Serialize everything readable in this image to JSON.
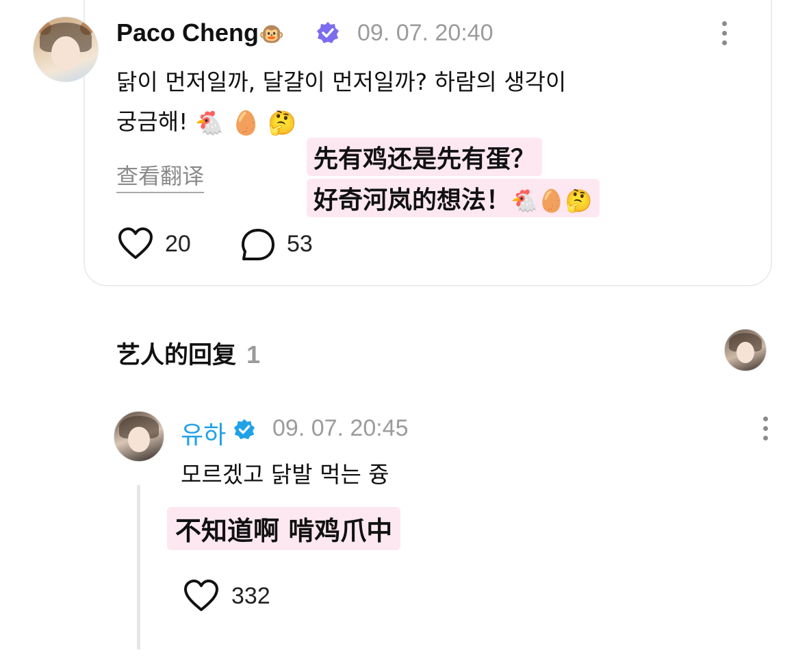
{
  "post": {
    "author": "Paco Cheng",
    "author_emoji": "🐵",
    "timestamp": "09. 07. 20:40",
    "text_line1": "닭이 먼저일까, 달걀이 먼저일까? 하람의 생각이",
    "text_line2": "궁금해!",
    "text_emojis": "🐔 🥚 🤔",
    "translate_label": "查看翻译",
    "translation_line1": "先有鸡还是先有蛋？",
    "translation_line2": "好奇河岚的想法！",
    "translation_emojis": "🐔🥚🤔",
    "likes": "20",
    "comments": "53"
  },
  "replies_section": {
    "title": "艺人的回复",
    "count": "1"
  },
  "reply": {
    "author": "유하",
    "timestamp": "09. 07. 20:45",
    "text": "모르겠고 닭발 먹는 즁",
    "translation": "不知道啊 啃鸡爪中",
    "likes": "332"
  },
  "colors": {
    "verified_badge": "#7c6cf0",
    "artist_badge": "#1fa2e6",
    "translation_highlight": "#fde8f1"
  },
  "icons": [
    "monkey-emoji",
    "verified-badge-icon",
    "kebab-menu-icon",
    "heart-icon",
    "comment-bubble-icon",
    "artist-check-icon"
  ]
}
